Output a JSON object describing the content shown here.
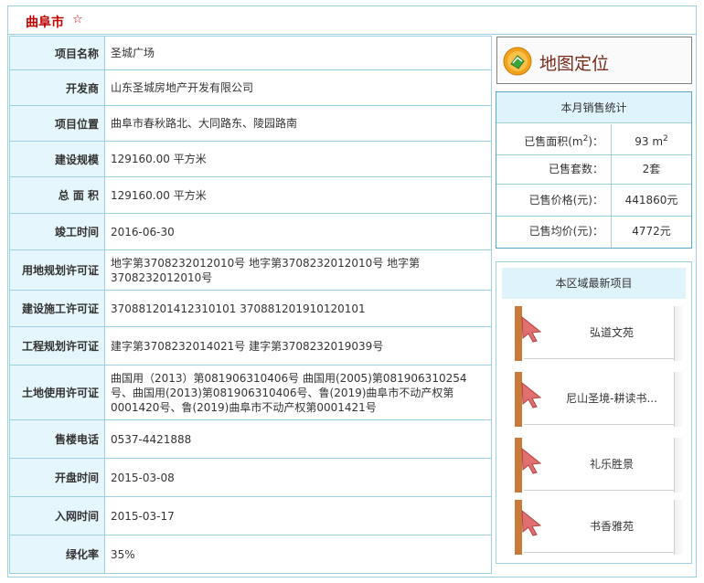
{
  "header": {
    "city": "曲阜市",
    "star": "☆"
  },
  "info_rows": [
    {
      "label": "项目名称",
      "value": "圣城广场"
    },
    {
      "label": "开发商",
      "value": "山东圣城房地产开发有限公司"
    },
    {
      "label": "项目位置",
      "value": "曲阜市春秋路北、大同路东、陵园路南"
    },
    {
      "label": "建设规模",
      "value": "129160.00 平方米"
    },
    {
      "label": "总 面 积",
      "value": "129160.00 平方米"
    },
    {
      "label": "竣工时间",
      "value": "2016-06-30"
    },
    {
      "label": "用地规划许可证",
      "value": "地字第3708232012010号 地字第3708232012010号 地字第3708232012010号"
    },
    {
      "label": "建设施工许可证",
      "value": "370881201412310101 370881201910120101"
    },
    {
      "label": "工程规划许可证",
      "value": "建字第3708232014021号 建字第3708232019039号"
    },
    {
      "label": "土地使用许可证",
      "value": "曲国用（2013）第081906310406号 曲国用(2005)第081906310254号、曲国用(2013)第081906310406号、鲁(2019)曲阜市不动产权第0001420号、鲁(2019)曲阜市不动产权第0001421号"
    },
    {
      "label": "售楼电话",
      "value": "0537-4421888"
    },
    {
      "label": "开盘时间",
      "value": "2015-03-08"
    },
    {
      "label": "入网时间",
      "value": "2015-03-17"
    },
    {
      "label": "绿化率",
      "value": "35%"
    }
  ],
  "map_button": {
    "label": "地图定位",
    "icon": "map-globe-icon"
  },
  "sales": {
    "title": "本月销售统计",
    "rows": [
      {
        "label": "已售面积(m",
        "label_sup": "2",
        "label_tail": ")：",
        "value": "93 m",
        "value_sup": "2"
      },
      {
        "label": "已售套数：",
        "label_sup": "",
        "label_tail": "",
        "value": "2套",
        "value_sup": ""
      },
      {
        "label": "已售价格(元)：",
        "label_sup": "",
        "label_tail": "",
        "value": "441860元",
        "value_sup": ""
      },
      {
        "label": "已售均价(元)：",
        "label_sup": "",
        "label_tail": "",
        "value": "4772元",
        "value_sup": ""
      }
    ]
  },
  "latest": {
    "title": "本区域最新项目",
    "items": [
      {
        "name": "弘道文苑"
      },
      {
        "name": "尼山圣境-耕读书..."
      },
      {
        "name": "礼乐胜景"
      },
      {
        "name": "书香雅苑"
      }
    ]
  },
  "colors": {
    "accent_red": "#c00000",
    "border": "#9ccfe0",
    "label_bg": "#e5f6fc",
    "header_bg": "#dff3fb"
  }
}
